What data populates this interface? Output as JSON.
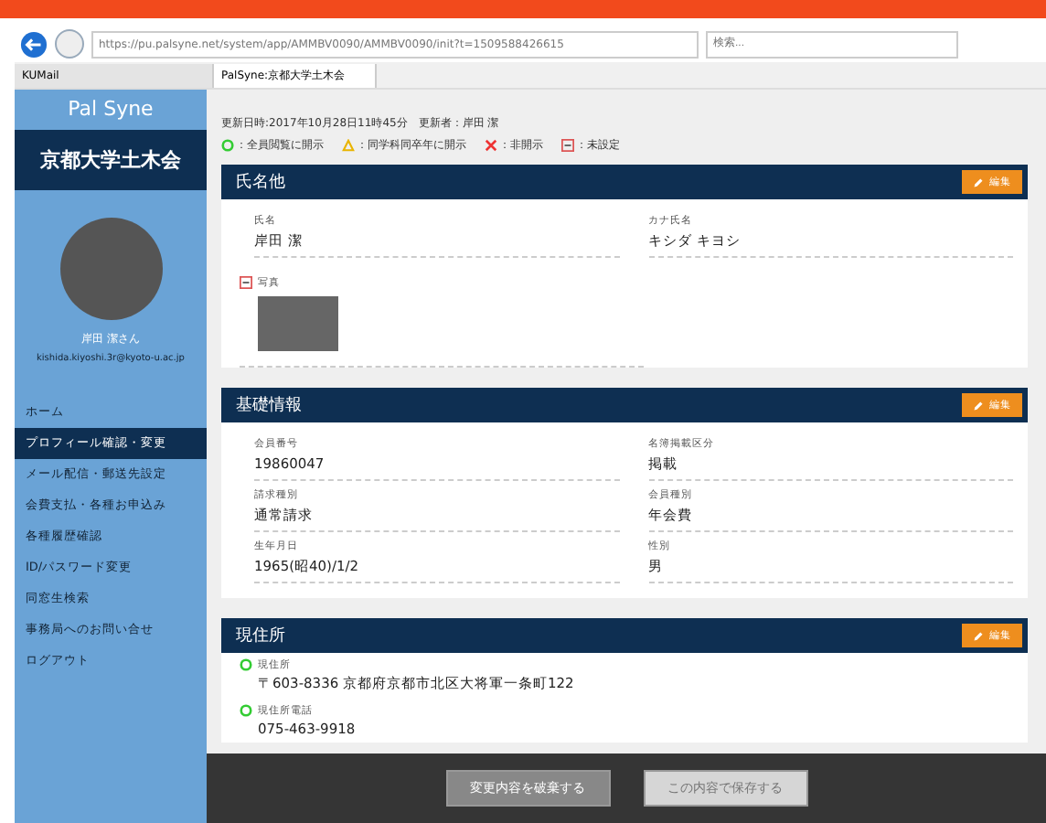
{
  "browser": {
    "url": "https://pu.palsyne.net/system/app/AMMBV0090/AMMBV0090/init?t=1509588426615",
    "search": {
      "placeholder": "検索..."
    },
    "tabs": [
      {
        "label": "KUMail",
        "selected": false
      },
      {
        "label": "PalSyne:京都大学土木会",
        "selected": true
      }
    ]
  },
  "sidebar": {
    "brand": "Pal Syne",
    "org": "京都大学土木会",
    "user_name": "岸田 潔さん",
    "email": "kishida.kiyoshi.3r@kyoto-u.ac.jp",
    "items": [
      {
        "label": "ホーム",
        "selected": false
      },
      {
        "label": "プロフィール確認・変更",
        "selected": true
      },
      {
        "label": "メール配信・郵送先設定",
        "selected": false
      },
      {
        "label": "会費支払・各種お申込み",
        "selected": false
      },
      {
        "label": "各種履歴確認",
        "selected": false
      },
      {
        "label": "ID/パスワード変更",
        "selected": false
      },
      {
        "label": "同窓生検索",
        "selected": false
      },
      {
        "label": "事務局へのお問い合せ",
        "selected": false
      },
      {
        "label": "ログアウト",
        "selected": false
      }
    ]
  },
  "update_info": "更新日時:2017年10月28日11時45分　更新者：岸田 潔",
  "legend": [
    {
      "kind": "circle",
      "label": "：全員閲覧に開示"
    },
    {
      "kind": "triangle",
      "label": "：同学科同卒年に開示"
    },
    {
      "kind": "cross",
      "label": "：非開示"
    },
    {
      "kind": "dash",
      "label": "：未設定"
    }
  ],
  "sections": [
    {
      "title": "氏名他",
      "edit_label": "編集",
      "fields": [
        {
          "label": "氏名",
          "value": "岸田 潔"
        },
        {
          "label": "カナ氏名",
          "value": "キシダ キヨシ"
        }
      ],
      "photo": {
        "label": "写真",
        "kind": "dash"
      }
    },
    {
      "title": "基礎情報",
      "edit_label": "編集",
      "fields": [
        {
          "label": "会員番号",
          "value": "19860047"
        },
        {
          "label": "名簿掲載区分",
          "value": "掲載"
        },
        {
          "label": "請求種別",
          "value": "通常請求"
        },
        {
          "label": "会員種別",
          "value": "年会費"
        },
        {
          "label": "生年月日",
          "value": "1965(昭40)/1/2"
        },
        {
          "label": "性別",
          "value": "男"
        }
      ]
    },
    {
      "title": "現住所",
      "edit_label": "編集",
      "entries": [
        {
          "label": "現住所",
          "value": "〒603-8336 京都府京都市北区大将軍一条町122",
          "kind": "circle"
        },
        {
          "label": "現住所電話",
          "value": "075-463-9918",
          "kind": "circle"
        }
      ]
    }
  ],
  "footer": {
    "buttons": [
      {
        "label": "変更内容を破棄する",
        "disabled": false
      },
      {
        "label": "この内容で保存する",
        "disabled": true
      }
    ]
  }
}
